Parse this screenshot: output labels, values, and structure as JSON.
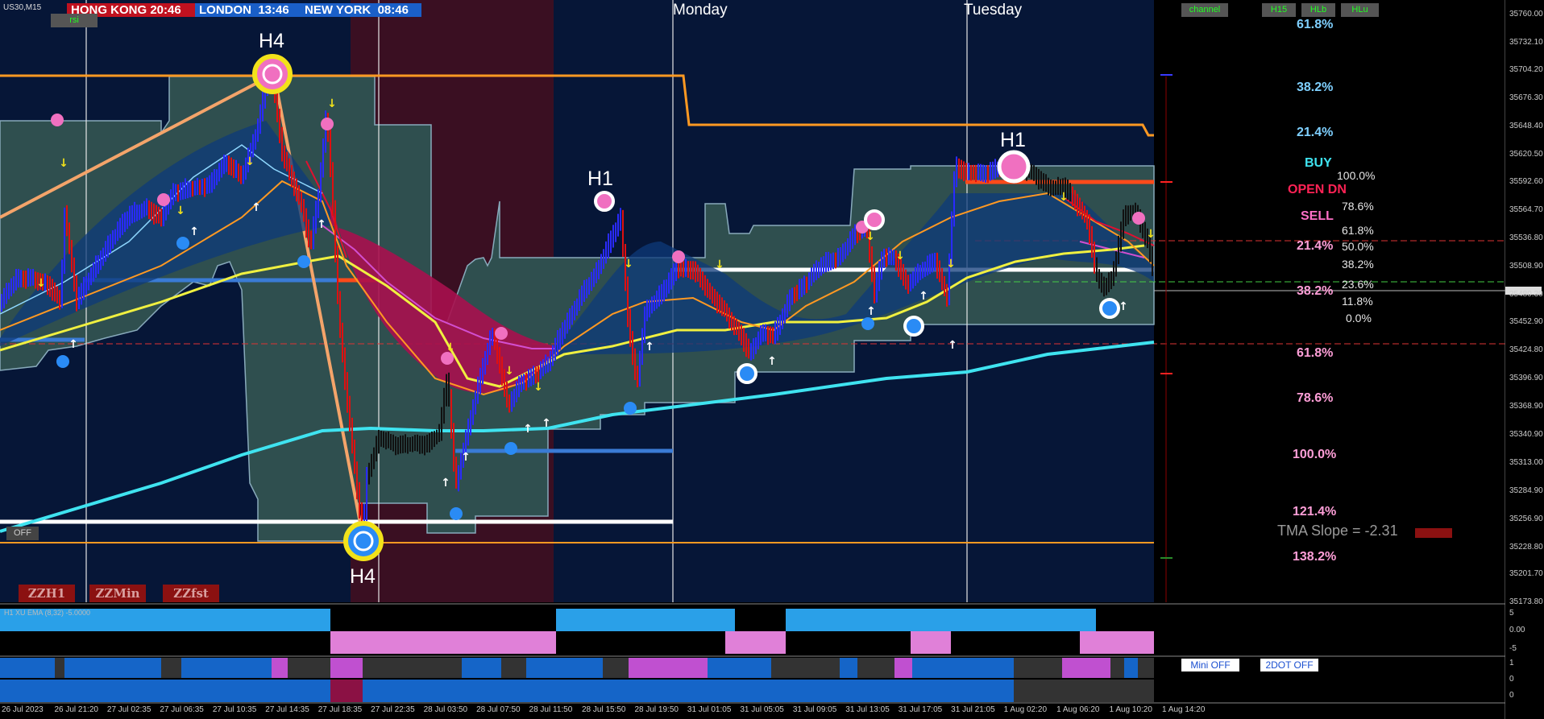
{
  "symbol": "US30,M15",
  "sessions": [
    {
      "name": "HONG KONG",
      "time": "20:46",
      "color": "#c0111f"
    },
    {
      "name": "LONDON",
      "time": "13:46",
      "color": "#1a5fc8"
    },
    {
      "name": "NEW YORK",
      "time": "08:46",
      "color": "#1a5fc8"
    }
  ],
  "buttons": {
    "rsi": "rsi",
    "off": "OFF",
    "channel": "channel",
    "h15": "H15",
    "hlb": "HLb",
    "hlu": "HLu",
    "mini_off": "Mini OFF",
    "twodot_off": "2DOT OFF"
  },
  "zz_buttons": [
    "ZZH1",
    "ZZMin",
    "ZZfst"
  ],
  "day_labels": [
    "Monday",
    "Tuesday"
  ],
  "swing_labels": [
    "H4",
    "H4",
    "H1",
    "H1"
  ],
  "fib_levels": [
    {
      "label": "61.8%",
      "color": "#7fd0ff"
    },
    {
      "label": "38.2%",
      "color": "#7fd0ff"
    },
    {
      "label": "21.4%",
      "color": "#7fd0ff"
    },
    {
      "label": "21.4%",
      "color": "#ff9fd8"
    },
    {
      "label": "38.2%",
      "color": "#ff9fd8"
    },
    {
      "label": "61.8%",
      "color": "#ff9fd8"
    },
    {
      "label": "78.6%",
      "color": "#ff9fd8"
    },
    {
      "label": "100.0%",
      "color": "#ff9fd8"
    },
    {
      "label": "121.4%",
      "color": "#ff9fd8"
    },
    {
      "label": "138.2%",
      "color": "#ff9fd8"
    }
  ],
  "status": {
    "buy": "BUY",
    "open": "OPEN DN",
    "sell": "SELL"
  },
  "fib_ratios": [
    "100.0%",
    "78.6%",
    "61.8%",
    "50.0%",
    "38.2%",
    "23.6%",
    "11.8%",
    "0.0%"
  ],
  "tma_slope": "TMA Slope = -2.31",
  "sub1_label": "H1 XU EMA (8,32) -5.0000",
  "sub1_scale": [
    "5",
    "0.00",
    "-5"
  ],
  "sub2_scale": [
    "1",
    "0",
    "0"
  ],
  "colors": {
    "bull": "#1a1aff",
    "bear": "#e01010",
    "cloud": "#2f4f4f",
    "tma": "#3fe3f0",
    "sess_red": "#3a0f22",
    "bg": "#061637"
  },
  "chart_data": {
    "type": "candlestick",
    "symbol": "US30",
    "timeframe": "M15",
    "price_axis": [
      "35760.00",
      "35732.10",
      "35704.20",
      "35676.30",
      "35648.40",
      "35620.50",
      "35592.60",
      "35564.70",
      "35536.80",
      "35508.90",
      "35500.30",
      "35480.30",
      "35452.90",
      "35424.80",
      "35396.90",
      "35368.90",
      "35340.90",
      "35313.00",
      "35284.90",
      "35256.90",
      "35228.80",
      "35201.70",
      "35173.80"
    ],
    "current_price": "35500.30",
    "time_axis": [
      "26 Jul 2023",
      "26 Jul 21:20",
      "27 Jul 02:35",
      "27 Jul 06:35",
      "27 Jul 10:35",
      "27 Jul 14:35",
      "27 Jul 18:35",
      "27 Jul 22:35",
      "28 Jul 03:50",
      "28 Jul 07:50",
      "28 Jul 11:50",
      "28 Jul 15:50",
      "28 Jul 19:50",
      "31 Jul 01:05",
      "31 Jul 05:05",
      "31 Jul 09:05",
      "31 Jul 13:05",
      "31 Jul 17:05",
      "31 Jul 21:05",
      "1 Aug 02:20",
      "1 Aug 06:20",
      "1 Aug 10:20",
      "1 Aug 14:20"
    ],
    "ylim": [
      35173.8,
      35760
    ],
    "price_path": [
      [
        0,
        35470
      ],
      [
        20,
        35495
      ],
      [
        40,
        35500
      ],
      [
        60,
        35490
      ],
      [
        75,
        35470
      ],
      [
        80,
        35560
      ],
      [
        95,
        35475
      ],
      [
        110,
        35500
      ],
      [
        140,
        35535
      ],
      [
        160,
        35560
      ],
      [
        180,
        35570
      ],
      [
        200,
        35555
      ],
      [
        215,
        35580
      ],
      [
        240,
        35590
      ],
      [
        260,
        35590
      ],
      [
        280,
        35610
      ],
      [
        300,
        35600
      ],
      [
        320,
        35650
      ],
      [
        335,
        35710
      ],
      [
        350,
        35620
      ],
      [
        360,
        35600
      ],
      [
        375,
        35570
      ],
      [
        385,
        35530
      ],
      [
        395,
        35580
      ],
      [
        405,
        35660
      ],
      [
        412,
        35580
      ],
      [
        420,
        35460
      ],
      [
        430,
        35380
      ],
      [
        440,
        35310
      ],
      [
        450,
        35240
      ],
      [
        455,
        35300
      ],
      [
        470,
        35335
      ],
      [
        490,
        35330
      ],
      [
        510,
        35335
      ],
      [
        530,
        35330
      ],
      [
        545,
        35340
      ],
      [
        555,
        35400
      ],
      [
        565,
        35290
      ],
      [
        575,
        35330
      ],
      [
        590,
        35380
      ],
      [
        610,
        35440
      ],
      [
        620,
        35410
      ],
      [
        630,
        35370
      ],
      [
        645,
        35395
      ],
      [
        665,
        35400
      ],
      [
        680,
        35410
      ],
      [
        700,
        35450
      ],
      [
        720,
        35480
      ],
      [
        740,
        35500
      ],
      [
        760,
        35540
      ],
      [
        770,
        35560
      ],
      [
        780,
        35450
      ],
      [
        790,
        35390
      ],
      [
        800,
        35460
      ],
      [
        820,
        35480
      ],
      [
        840,
        35510
      ],
      [
        860,
        35505
      ],
      [
        880,
        35480
      ],
      [
        900,
        35465
      ],
      [
        920,
        35440
      ],
      [
        930,
        35420
      ],
      [
        945,
        35440
      ],
      [
        960,
        35440
      ],
      [
        980,
        35480
      ],
      [
        1000,
        35490
      ],
      [
        1020,
        35510
      ],
      [
        1040,
        35520
      ],
      [
        1060,
        35540
      ],
      [
        1075,
        35545
      ],
      [
        1085,
        35480
      ],
      [
        1095,
        35520
      ],
      [
        1110,
        35520
      ],
      [
        1125,
        35490
      ],
      [
        1140,
        35500
      ],
      [
        1160,
        35515
      ],
      [
        1175,
        35480
      ],
      [
        1185,
        35610
      ],
      [
        1200,
        35600
      ],
      [
        1220,
        35600
      ],
      [
        1240,
        35610
      ],
      [
        1260,
        35605
      ],
      [
        1280,
        35600
      ],
      [
        1300,
        35590
      ],
      [
        1320,
        35590
      ],
      [
        1335,
        35570
      ],
      [
        1350,
        35550
      ],
      [
        1360,
        35500
      ],
      [
        1370,
        35490
      ],
      [
        1380,
        35500
      ],
      [
        1395,
        35560
      ],
      [
        1410,
        35560
      ],
      [
        1425,
        35530
      ],
      [
        1432,
        35500
      ]
    ]
  }
}
